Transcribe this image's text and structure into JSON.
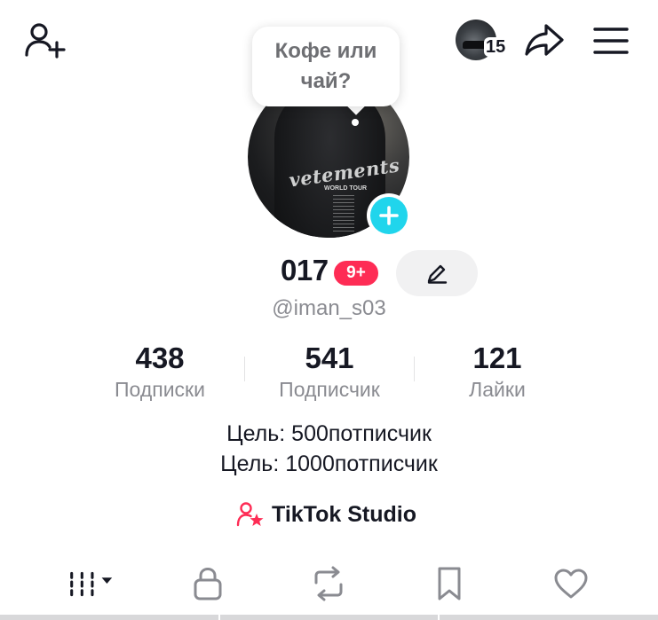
{
  "header": {
    "add_friend_icon": "add-user-icon",
    "story_count": "15",
    "share_icon": "share-arrow-icon",
    "menu_icon": "hamburger-menu-icon"
  },
  "bubble": {
    "line1": "Кофе или",
    "line2": "чай?"
  },
  "profile": {
    "nickname": "017",
    "notification_badge": "9+",
    "handle": "@iman_s03",
    "avatar_brand": "vetements",
    "avatar_subtitle": "WORLD TOUR",
    "edit_icon": "pencil-icon"
  },
  "stats": [
    {
      "value": "438",
      "label": "Подписки"
    },
    {
      "value": "541",
      "label": "Подписчик"
    },
    {
      "value": "121",
      "label": "Лайки"
    }
  ],
  "bio": {
    "line1": "Цель: 500потписчик",
    "line2": "Цель: 1000потписчик"
  },
  "studio": {
    "label": "TikTok Studio",
    "icon": "creator-star-icon"
  },
  "tabs": [
    {
      "icon": "grid-videos-icon",
      "active": true
    },
    {
      "icon": "lock-icon",
      "active": false
    },
    {
      "icon": "repost-icon",
      "active": false
    },
    {
      "icon": "bookmark-icon",
      "active": false
    },
    {
      "icon": "heart-icon",
      "active": false
    }
  ],
  "colors": {
    "accent_red": "#fe2c55",
    "accent_cyan": "#20d5ec",
    "text_primary": "#161823",
    "text_secondary": "#8a8b91"
  }
}
